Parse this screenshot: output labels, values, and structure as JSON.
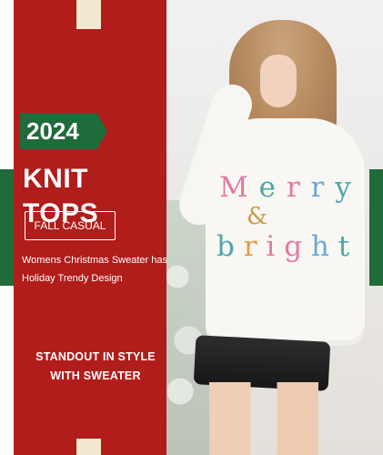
{
  "banner": {
    "year": "2024",
    "title": "KNIT TOPS",
    "tag": "FALL CASUAL",
    "description": [
      "Womens Christmas Sweater has",
      "Holiday Trendy Design"
    ],
    "tagline": [
      "STANDOUT IN STYLE",
      "WITH SWEATER"
    ]
  },
  "sweater_text": {
    "word1": [
      "M",
      "e",
      "r",
      "r",
      "y"
    ],
    "amp": "&",
    "word2": [
      "b",
      "r",
      "i",
      "g",
      "h",
      "t"
    ]
  },
  "colors": {
    "panel_red": "#b01d1b",
    "badge_green": "#1f6b3a",
    "notch_cream": "#f1e9d0",
    "letter_pink": "#e27aa3",
    "letter_teal": "#4fa7a6",
    "letter_blue": "#6da8d6",
    "letter_orange": "#e39a4b",
    "letter_gold": "#c9a04a"
  }
}
